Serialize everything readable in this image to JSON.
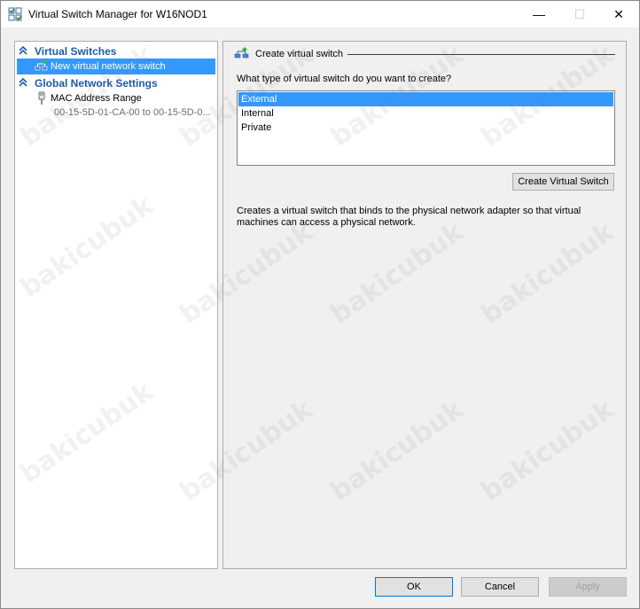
{
  "window": {
    "title": "Virtual Switch Manager for W16NOD1",
    "minimize_glyph": "—",
    "maximize_glyph": "☐",
    "close_glyph": "✕"
  },
  "sidebar": {
    "sections": [
      {
        "label": "Virtual Switches",
        "items": [
          {
            "label": "New virtual network switch",
            "icon": "network-switch-add-icon",
            "selected": true
          }
        ]
      },
      {
        "label": "Global Network Settings",
        "items": [
          {
            "label": "MAC Address Range",
            "icon": "network-plug-icon",
            "sub": "00-15-5D-01-CA-00 to 00-15-5D-0..."
          }
        ]
      }
    ]
  },
  "main": {
    "group_title": "Create virtual switch",
    "question": "What type of virtual switch do you want to create?",
    "switch_types": [
      "External",
      "Internal",
      "Private"
    ],
    "selected_type": "External",
    "create_button": "Create Virtual Switch",
    "description": "Creates a virtual switch that binds to the physical network adapter so that virtual machines can access a physical network."
  },
  "footer": {
    "ok": "OK",
    "cancel": "Cancel",
    "apply": "Apply"
  },
  "watermark": "bakicubuk",
  "colors": {
    "selection": "#3399ff",
    "section_header": "#1e5aa8",
    "ok_border": "#0078d7"
  }
}
